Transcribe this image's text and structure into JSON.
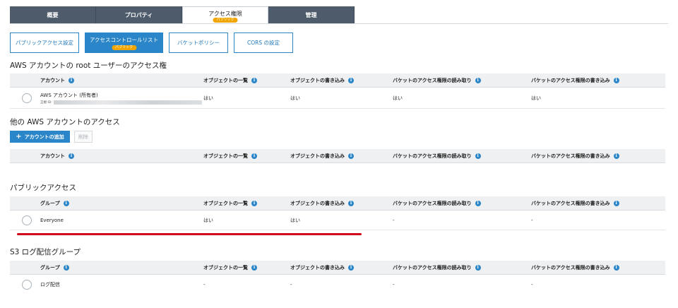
{
  "tabs": [
    {
      "label": "概要"
    },
    {
      "label": "プロパティ"
    },
    {
      "label": "アクセス権限",
      "badge": "パブリック"
    },
    {
      "label": "管理"
    }
  ],
  "subtabs": [
    {
      "label": "パブリックアクセス設定"
    },
    {
      "label": "アクセスコントロールリスト",
      "badge": "パブリック"
    },
    {
      "label": "バケットポリシー"
    },
    {
      "label": "CORS の設定"
    }
  ],
  "columns": {
    "account": "アカウント",
    "group": "グループ",
    "list_objects": "オブジェクトの一覧",
    "write_objects": "オブジェクトの書き込み",
    "read_acl": "バケットのアクセス権限の読み取り",
    "write_acl": "バケットのアクセス権限の書き込み"
  },
  "root_section": {
    "title": "AWS アカウントの root ユーザーのアクセス権",
    "row": {
      "name": "AWS アカウント (所有者)",
      "id_label": "正規 ID:",
      "list": "はい",
      "write": "はい",
      "read_acl": "はい",
      "write_acl": "はい"
    }
  },
  "other_section": {
    "title": "他の AWS アカウントのアクセス",
    "add_button": "アカウントの追加",
    "delete_button": "削除"
  },
  "public_section": {
    "title": "パブリックアクセス",
    "row": {
      "name": "Everyone",
      "list": "はい",
      "write": "はい",
      "read_acl": "-",
      "write_acl": "-"
    }
  },
  "log_section": {
    "title": "S3 ログ配信グループ",
    "row": {
      "name": "ログ配信",
      "list": "-",
      "write": "-",
      "read_acl": "-",
      "write_acl": "-"
    }
  },
  "colors": {
    "tab_bg": "#4d5b6a",
    "accent": "#2a86c8",
    "badge": "#f0a500",
    "highlight": "#d0021b"
  }
}
